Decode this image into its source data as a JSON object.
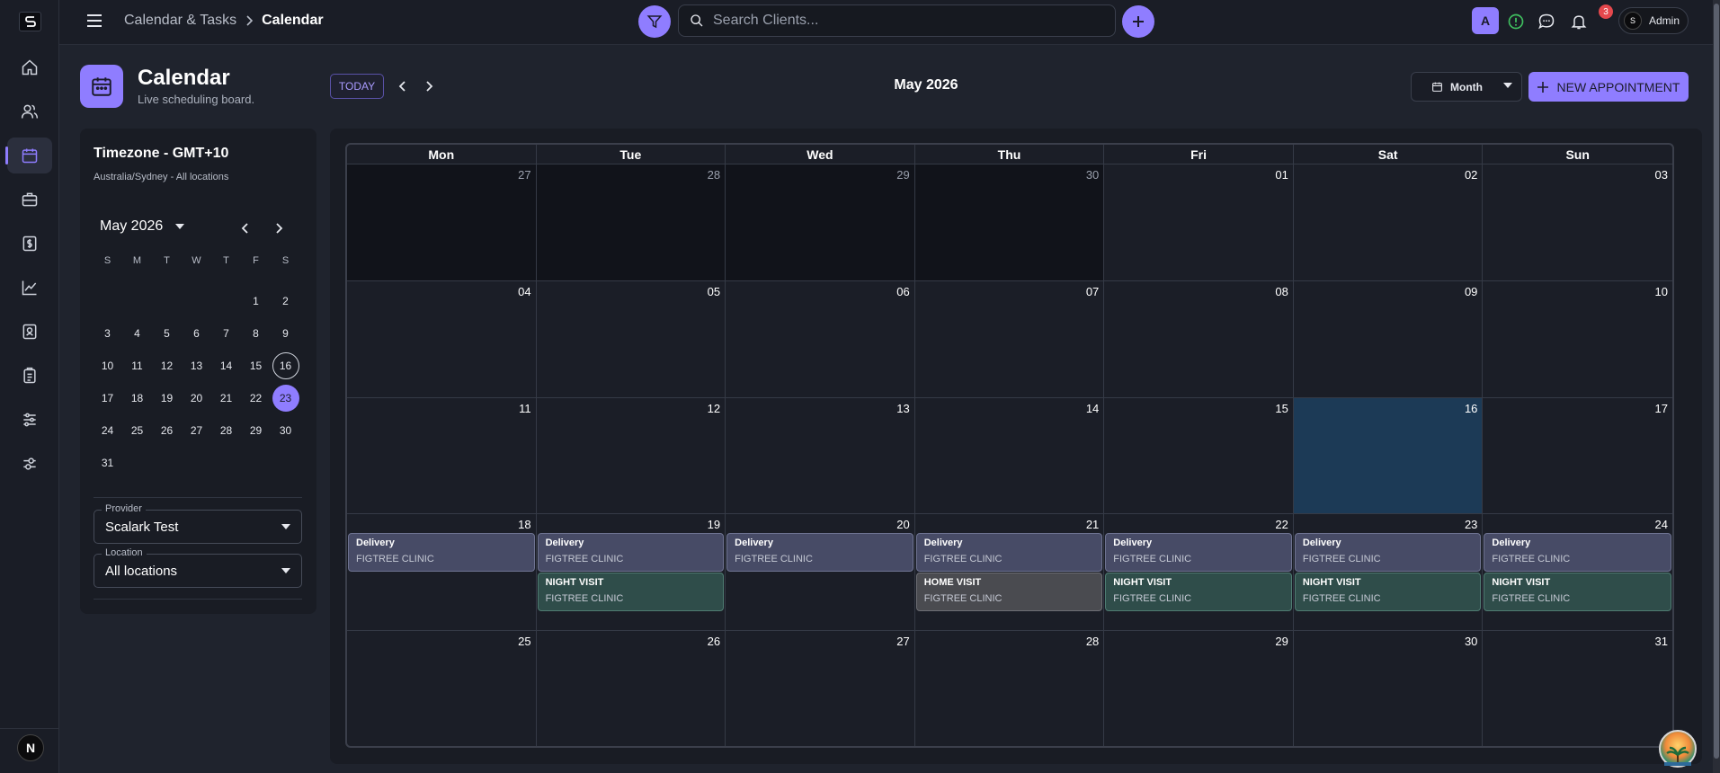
{
  "topbar": {
    "breadcrumb_parent": "Calendar & Tasks",
    "breadcrumb_current": "Calendar",
    "search_placeholder": "Search Clients...",
    "avatar_letter": "A",
    "notification_count": "3",
    "admin_label": "Admin"
  },
  "sidebar": {
    "items": [
      "home-icon",
      "users-icon",
      "calendar-icon",
      "briefcase-icon",
      "invoice-icon",
      "chart-icon",
      "contacts-icon",
      "clipboard-icon",
      "sliders-icon",
      "settings-icon"
    ],
    "active": "calendar-icon",
    "bottom_letter": "N"
  },
  "header": {
    "title": "Calendar",
    "subtitle": "Live scheduling board.",
    "today_label": "TODAY",
    "month_label": "May 2026",
    "view_label": "Month",
    "new_appointment_label": "NEW APPOINTMENT"
  },
  "left_panel": {
    "timezone_title": "Timezone - GMT+10",
    "timezone_sub": "Australia/Sydney - All locations",
    "mini_month": "May 2026",
    "weekdays": [
      "S",
      "M",
      "T",
      "W",
      "T",
      "F",
      "S"
    ],
    "weeks": [
      [
        "",
        "",
        "",
        "",
        "",
        "1",
        "2"
      ],
      [
        "3",
        "4",
        "5",
        "6",
        "7",
        "8",
        "9"
      ],
      [
        "10",
        "11",
        "12",
        "13",
        "14",
        "15",
        "16"
      ],
      [
        "17",
        "18",
        "19",
        "20",
        "21",
        "22",
        "23"
      ],
      [
        "24",
        "25",
        "26",
        "27",
        "28",
        "29",
        "30"
      ],
      [
        "31",
        "",
        "",
        "",
        "",
        "",
        ""
      ]
    ],
    "outlined_day": "16",
    "selected_day": "23",
    "provider_label": "Provider",
    "provider_value": "Scalark Test",
    "location_label": "Location",
    "location_value": "All locations"
  },
  "calendar": {
    "weekdays": [
      "Mon",
      "Tue",
      "Wed",
      "Thu",
      "Fri",
      "Sat",
      "Sun"
    ],
    "weeks": [
      [
        {
          "n": "27",
          "other": true
        },
        {
          "n": "28",
          "other": true
        },
        {
          "n": "29",
          "other": true
        },
        {
          "n": "30",
          "other": true
        },
        {
          "n": "01"
        },
        {
          "n": "02"
        },
        {
          "n": "03"
        }
      ],
      [
        {
          "n": "04"
        },
        {
          "n": "05"
        },
        {
          "n": "06"
        },
        {
          "n": "07"
        },
        {
          "n": "08"
        },
        {
          "n": "09"
        },
        {
          "n": "10"
        }
      ],
      [
        {
          "n": "11"
        },
        {
          "n": "12"
        },
        {
          "n": "13"
        },
        {
          "n": "14"
        },
        {
          "n": "15"
        },
        {
          "n": "16",
          "highlight": true
        },
        {
          "n": "17"
        }
      ],
      [
        {
          "n": "18",
          "events": [
            {
              "title": "Delivery",
              "loc": "FIGTREE CLINIC",
              "kind": "delivery"
            }
          ]
        },
        {
          "n": "19",
          "events": [
            {
              "title": "Delivery",
              "loc": "FIGTREE CLINIC",
              "kind": "delivery"
            },
            {
              "title": "NIGHT VISIT",
              "loc": "FIGTREE CLINIC",
              "kind": "night"
            }
          ]
        },
        {
          "n": "20",
          "events": [
            {
              "title": "Delivery",
              "loc": "FIGTREE CLINIC",
              "kind": "delivery"
            }
          ]
        },
        {
          "n": "21",
          "events": [
            {
              "title": "Delivery",
              "loc": "FIGTREE CLINIC",
              "kind": "delivery"
            },
            {
              "title": "HOME VISIT",
              "loc": "FIGTREE CLINIC",
              "kind": "home"
            }
          ]
        },
        {
          "n": "22",
          "events": [
            {
              "title": "Delivery",
              "loc": "FIGTREE CLINIC",
              "kind": "delivery"
            },
            {
              "title": "NIGHT VISIT",
              "loc": "FIGTREE CLINIC",
              "kind": "night"
            }
          ]
        },
        {
          "n": "23",
          "events": [
            {
              "title": "Delivery",
              "loc": "FIGTREE CLINIC",
              "kind": "delivery"
            },
            {
              "title": "NIGHT VISIT",
              "loc": "FIGTREE CLINIC",
              "kind": "night"
            }
          ]
        },
        {
          "n": "24",
          "events": [
            {
              "title": "Delivery",
              "loc": "FIGTREE CLINIC",
              "kind": "delivery"
            },
            {
              "title": "NIGHT VISIT",
              "loc": "FIGTREE CLINIC",
              "kind": "night"
            }
          ]
        }
      ],
      [
        {
          "n": "25"
        },
        {
          "n": "26"
        },
        {
          "n": "27"
        },
        {
          "n": "28"
        },
        {
          "n": "29"
        },
        {
          "n": "30"
        },
        {
          "n": "31"
        }
      ]
    ]
  },
  "colors": {
    "accent": "#8f7dff",
    "background": "#1f232d",
    "delivery_event": "#474b66",
    "night_event": "#2f4d4a",
    "home_event": "#4a4b50",
    "highlight_day": "#1c3a56"
  }
}
